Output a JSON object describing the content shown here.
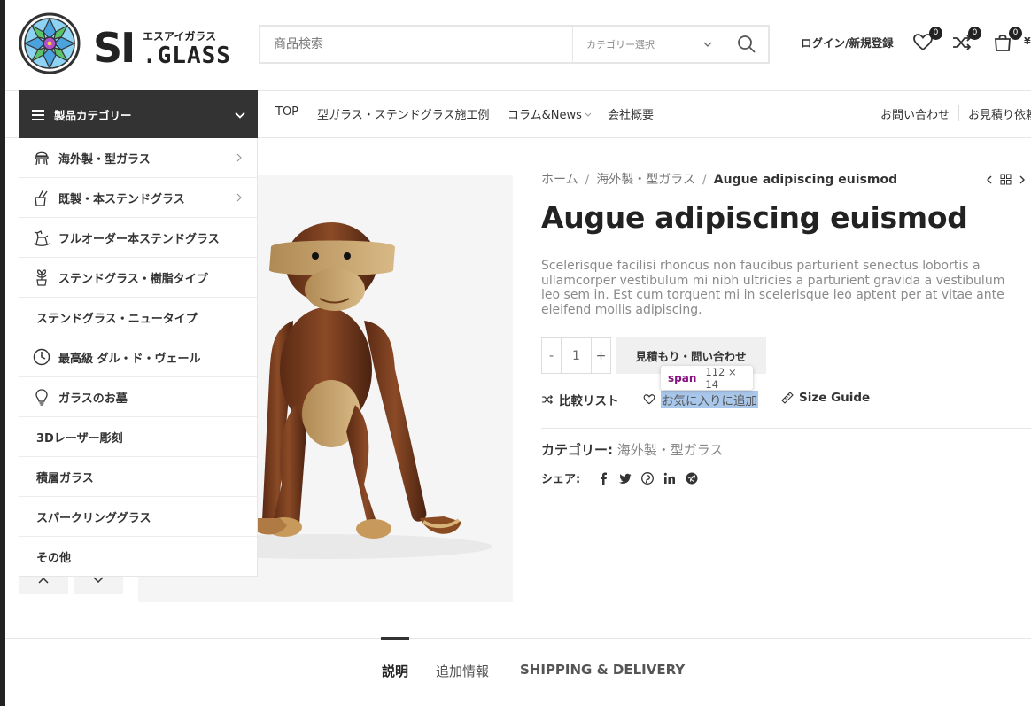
{
  "brand": {
    "kana": "エスアイガラス",
    "name_si": "SI",
    "name_glass": ".GLASS"
  },
  "search": {
    "placeholder": "商品検索",
    "category_label": "カテゴリー選択"
  },
  "header": {
    "login_label": "ログイン/新規登録",
    "wishlist_count": "0",
    "compare_count": "0",
    "cart_count": "0",
    "price_prefix": "¥"
  },
  "nav": {
    "categories_label": "製品カテゴリー",
    "links": [
      "TOP",
      "型ガラス・ステンドグラス施工例",
      "コラム&News",
      "会社概要"
    ],
    "right_links": [
      "お問い合わせ",
      "お見積り依頼"
    ]
  },
  "category_menu": [
    {
      "label": "海外製・型ガラス",
      "icon": "chair-icon",
      "has_sub": true
    },
    {
      "label": "既製・本ステンドグラス",
      "icon": "kitchen-icon",
      "has_sub": true
    },
    {
      "label": "フルオーダー本ステンドグラス",
      "icon": "rocking-horse-icon",
      "has_sub": false
    },
    {
      "label": "ステンドグラス・樹脂タイプ",
      "icon": "plant-icon",
      "has_sub": false
    },
    {
      "label": "ステンドグラス・ニュータイプ",
      "icon": "",
      "has_sub": false
    },
    {
      "label": "最高級 ダル・ド・ヴェール",
      "icon": "clock-icon",
      "has_sub": false
    },
    {
      "label": "ガラスのお墓",
      "icon": "bulb-icon",
      "has_sub": false
    },
    {
      "label": "3Dレーザー彫刻",
      "icon": "",
      "has_sub": false
    },
    {
      "label": "積層ガラス",
      "icon": "",
      "has_sub": false
    },
    {
      "label": "スパークリンググラス",
      "icon": "",
      "has_sub": false
    },
    {
      "label": "その他",
      "icon": "",
      "has_sub": false
    }
  ],
  "breadcrumb": [
    "ホーム",
    "海外製・型ガラス",
    "Augue adipiscing euismod"
  ],
  "product": {
    "title": "Augue adipiscing euismod",
    "description": "Scelerisque facilisi rhoncus non faucibus parturient senectus lobortis a ullamcorper vestibulum mi nibh ultricies a parturient gravida a vestibulum leo sem in. Est cum torquent mi in scelerisque leo aptent per at vitae ante eleifend mollis adipiscing.",
    "qty_minus": "-",
    "qty_value": "1",
    "qty_plus": "+",
    "cta_label": "見積もり・問い合わせ",
    "compare_label": "比較リスト",
    "wishlist_label": "お気に入りに追加",
    "size_guide_label": "Size Guide",
    "category_key": "カテゴリー:",
    "category_value": "海外製・型ガラス",
    "share_label": "シェア:"
  },
  "inspector_tooltip": {
    "tag": "span",
    "dims": "112 × 14"
  },
  "tabs": [
    "説明",
    "追加情報",
    "SHIPPING & DELIVERY"
  ],
  "colors": {
    "dark": "#333333",
    "highlight": "#a8c7ea",
    "tooltip_tag": "#881280"
  }
}
